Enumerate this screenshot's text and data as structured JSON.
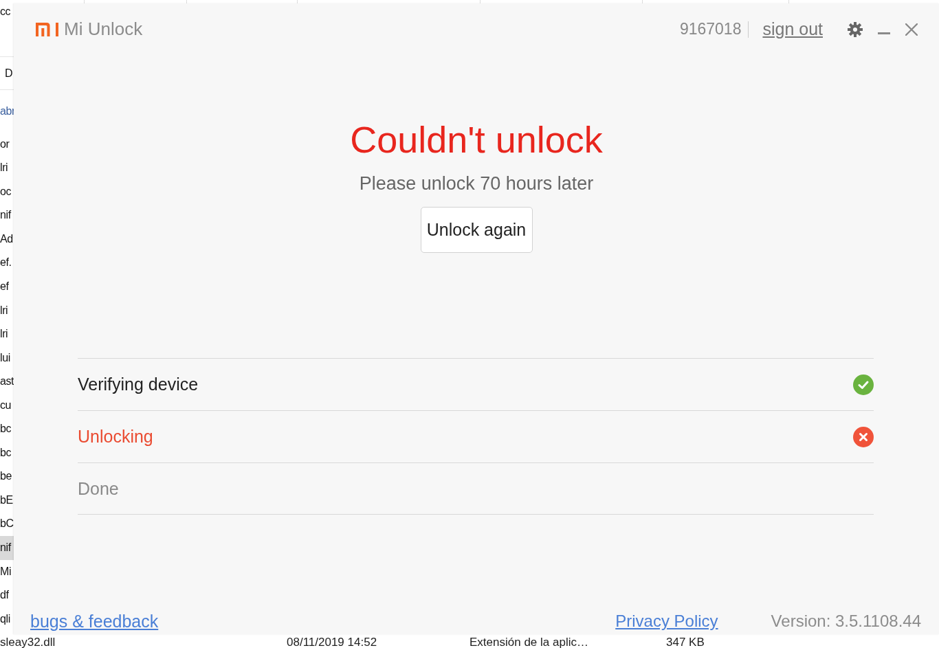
{
  "background_window": {
    "nav_pane": {
      "header": "cc",
      "column_header": "D",
      "link": "abr"
    },
    "file_rows": [
      {
        "text": "or",
        "selected": false
      },
      {
        "text": "lri",
        "selected": false
      },
      {
        "text": "oc",
        "selected": false
      },
      {
        "text": "nif",
        "selected": false
      },
      {
        "text": "Ad",
        "selected": false
      },
      {
        "text": "ef.",
        "selected": false
      },
      {
        "text": "ef",
        "selected": false
      },
      {
        "text": "lri",
        "selected": false
      },
      {
        "text": "lri",
        "selected": false
      },
      {
        "text": "lui",
        "selected": false
      },
      {
        "text": "ast",
        "selected": false
      },
      {
        "text": "cu",
        "selected": false
      },
      {
        "text": "bc",
        "selected": false
      },
      {
        "text": "bc",
        "selected": false
      },
      {
        "text": "be",
        "selected": false
      },
      {
        "text": "bE",
        "selected": false
      },
      {
        "text": "bC",
        "selected": false
      },
      {
        "text": "nif",
        "selected": true
      },
      {
        "text": "Mi",
        "selected": false
      },
      {
        "text": "df",
        "selected": false
      },
      {
        "text": "qli",
        "selected": false
      }
    ],
    "last_file": {
      "name": "sleay32.dll",
      "modified": "08/11/2019 14:52",
      "type": "Extensión de la aplic…",
      "size": "347 KB"
    }
  },
  "app": {
    "title": "Mi Unlock",
    "account_id": "9167018",
    "sign_out": "sign out",
    "heading": "Couldn't unlock",
    "message": "Please unlock 70 hours later",
    "button": "Unlock again",
    "steps": [
      {
        "label": "Verifying device",
        "kind": "done"
      },
      {
        "label": "Unlocking",
        "kind": "failed"
      },
      {
        "label": "Done",
        "kind": "pending"
      }
    ],
    "footer": {
      "feedback_link": "bugs & feedback",
      "privacy_link": "Privacy Policy",
      "version": "Version: 3.5.1108.44"
    }
  }
}
